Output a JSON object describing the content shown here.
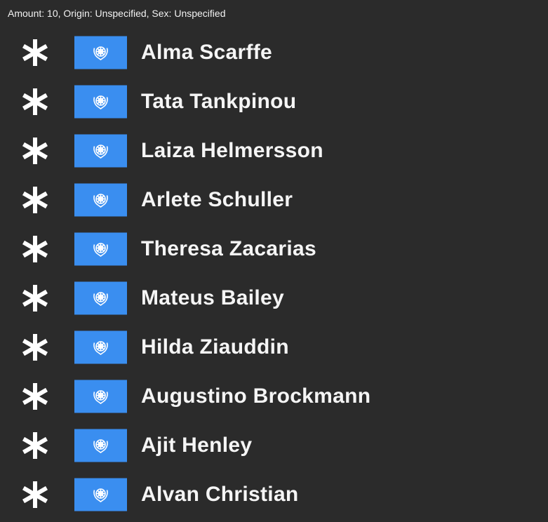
{
  "header": {
    "summary": "Amount: 10, Origin: Unspecified, Sex: Unspecified"
  },
  "colors": {
    "background": "#2b2b2b",
    "flag_blue": "#3a8ef0",
    "text": "#f5f5f5"
  },
  "icons": {
    "marker": "asterisk-icon",
    "flag": "un-flag-icon"
  },
  "people": [
    {
      "name": "Alma Scarffe"
    },
    {
      "name": "Tata Tankpinou"
    },
    {
      "name": "Laiza Helmersson"
    },
    {
      "name": "Arlete Schuller"
    },
    {
      "name": "Theresa Zacarias"
    },
    {
      "name": "Mateus Bailey"
    },
    {
      "name": "Hilda Ziauddin"
    },
    {
      "name": "Augustino Brockmann"
    },
    {
      "name": "Ajit Henley"
    },
    {
      "name": "Alvan Christian"
    }
  ]
}
